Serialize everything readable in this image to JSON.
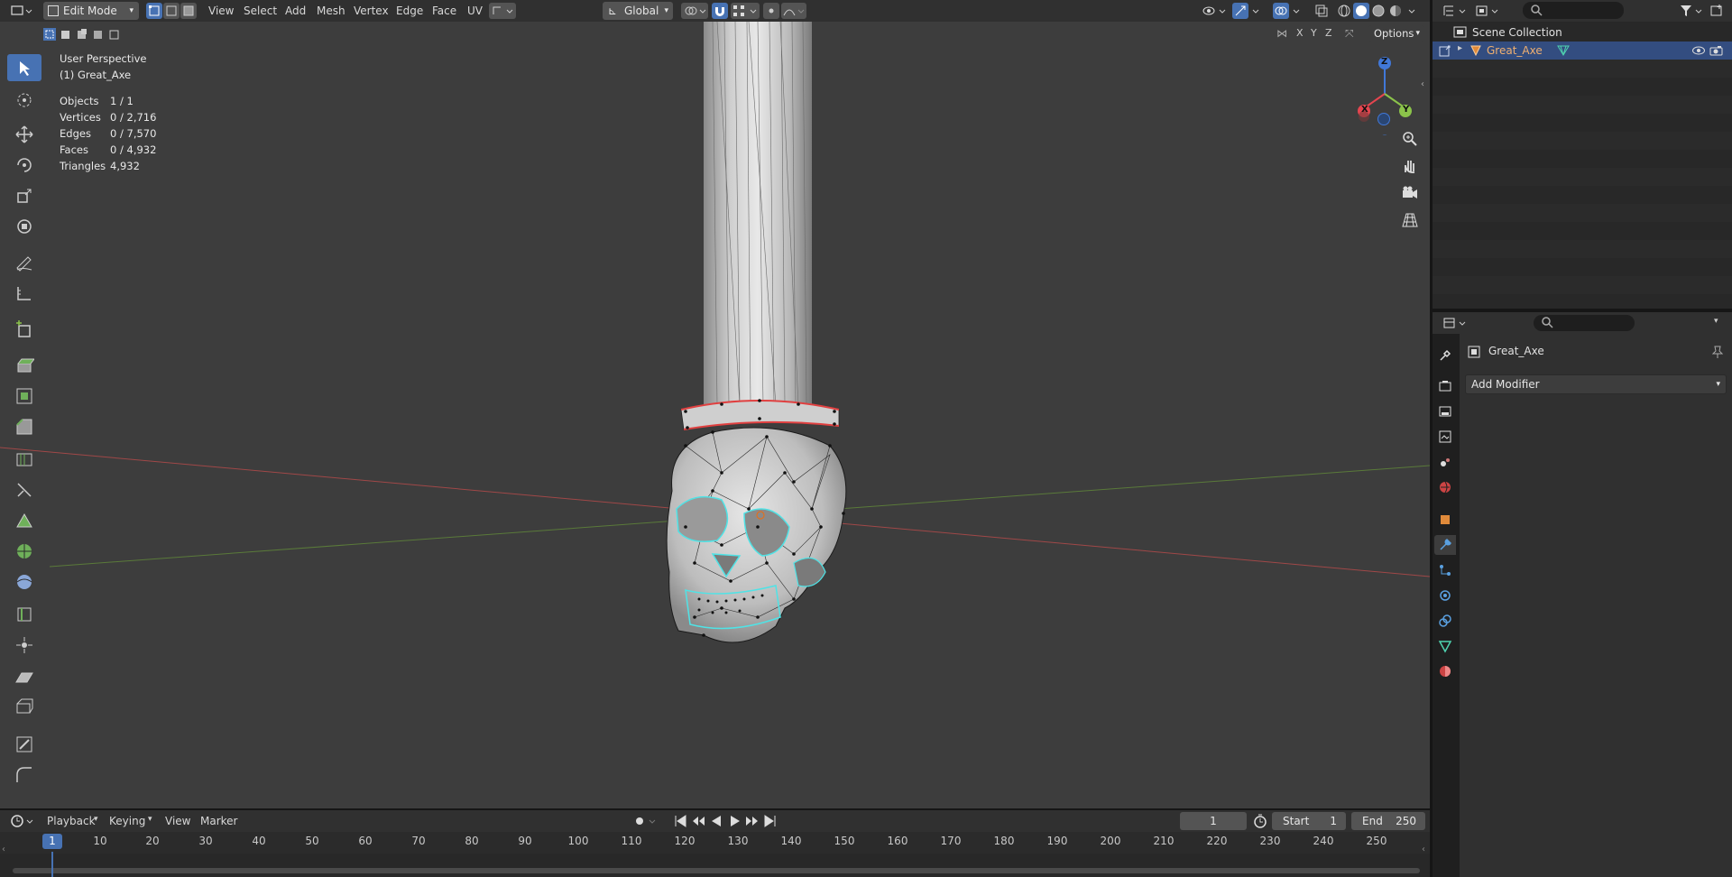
{
  "header": {
    "mode": "Edit Mode",
    "menus": [
      "View",
      "Select",
      "Add",
      "Mesh",
      "Vertex",
      "Edge",
      "Face",
      "UV"
    ],
    "orientation": "Global",
    "options_label": "Options",
    "axes": [
      "X",
      "Y",
      "Z"
    ]
  },
  "overlay": {
    "perspective": "User Perspective",
    "object_line": "(1) Great_Axe",
    "stats": [
      {
        "label": "Objects",
        "value": "1 / 1"
      },
      {
        "label": "Vertices",
        "value": "0 / 2,716"
      },
      {
        "label": "Edges",
        "value": "0 / 7,570"
      },
      {
        "label": "Faces",
        "value": "0 / 4,932"
      },
      {
        "label": "Triangles",
        "value": "4,932"
      }
    ]
  },
  "gizmo": {
    "x": "X",
    "y": "Y",
    "z": "Z"
  },
  "outliner": {
    "collection": "Scene Collection",
    "object": "Great_Axe"
  },
  "properties": {
    "object_name": "Great_Axe",
    "add_modifier": "Add Modifier"
  },
  "timeline": {
    "menus": [
      "Playback",
      "Keying",
      "View",
      "Marker"
    ],
    "current_frame": "1",
    "start_label": "Start",
    "start_value": "1",
    "end_label": "End",
    "end_value": "250",
    "ticks": [
      "1",
      "10",
      "20",
      "30",
      "40",
      "50",
      "60",
      "70",
      "80",
      "90",
      "100",
      "110",
      "120",
      "130",
      "140",
      "150",
      "160",
      "170",
      "180",
      "190",
      "200",
      "210",
      "220",
      "230",
      "240",
      "250"
    ]
  },
  "colors": {
    "viewport_bg": "#3d3d3d",
    "panel_bg": "#303030",
    "accent": "#4772b3",
    "selection_cyan": "#4fe3e6",
    "seam_red": "#e04040",
    "x_axis": "#e5454f",
    "y_axis": "#8bc34a",
    "z_axis": "#4178d8"
  }
}
